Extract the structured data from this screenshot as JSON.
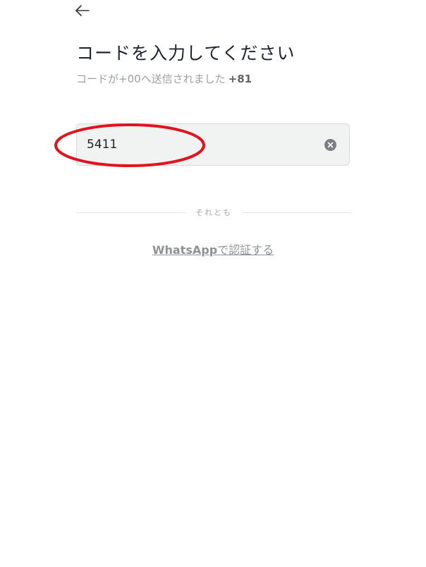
{
  "header": {
    "back_icon": "arrow-left-icon",
    "title": "コードを入力してください",
    "subtitle_prefix": "コードが+00へ送信されました",
    "subtitle_number": "+81"
  },
  "code_input": {
    "value": "5411",
    "clear_icon": "clear-circle-icon"
  },
  "annotation": {
    "color": "#e0141e"
  },
  "divider": {
    "label": "それとも"
  },
  "alt_verify": {
    "brand": "WhatsApp",
    "suffix": "で認証する"
  }
}
